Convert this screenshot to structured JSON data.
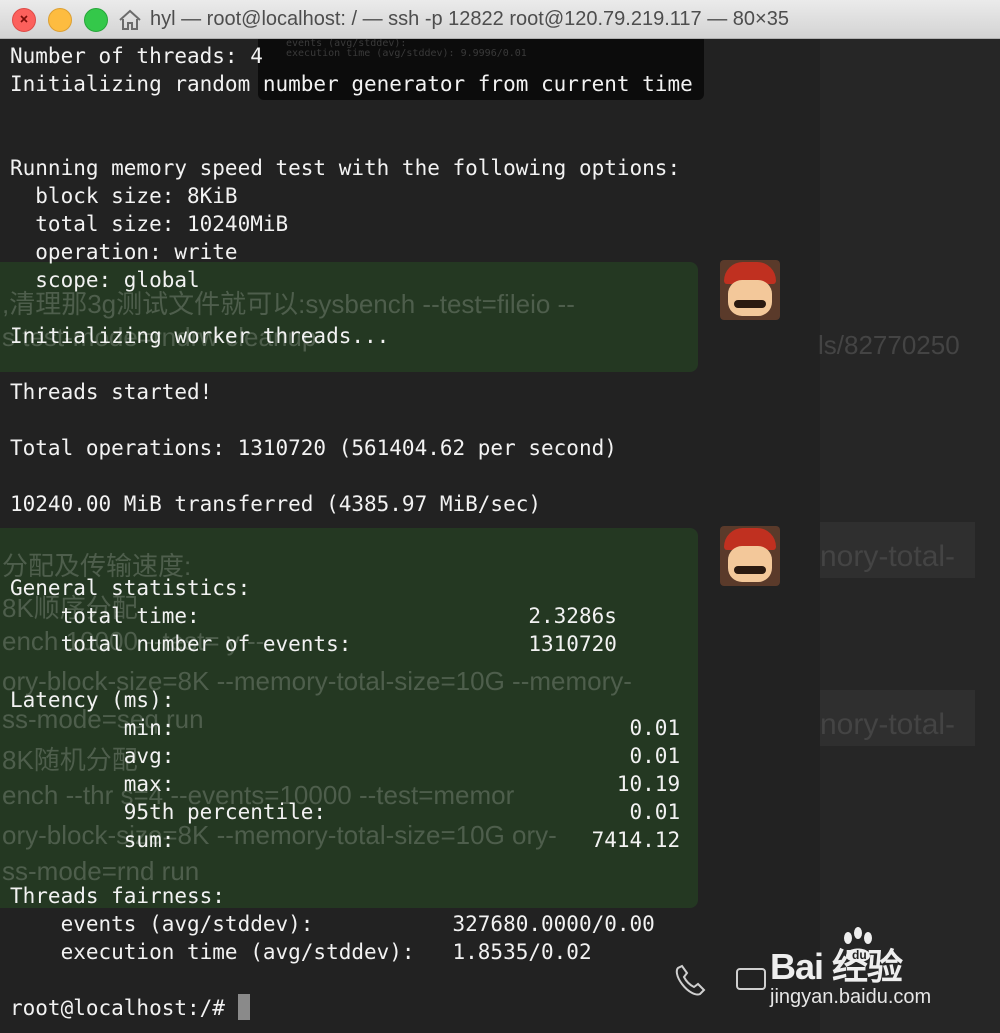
{
  "window": {
    "title": "hyl — root@localhost: / — ssh -p 12822 root@120.79.219.117 — 80×35"
  },
  "overlay": {
    "lines": [
      "events (avg/stddev):",
      "execution time (avg/stddev):    9.9996/0.01"
    ]
  },
  "background_chat": {
    "bubble1": [
      ",清理那3g测试文件就可以:sysbench --test=fileio --",
      "s                                           test-mode=rndrw cleanup"
    ],
    "bubble2": [
      "分配及传输速度:",
      "8K顺序分配",
      "ench                                 10000 --test=                  y --",
      "ory-block-size=8K --memory-total-size=10G --memory-",
      "ss-mode=seq run",
      "8K随机分配",
      "ench --thr       s=4 --events=10000 --test=memor",
      "ory-block-size=8K --memory-total-size=10G        ory-",
      "ss-mode=rnd run"
    ],
    "right_texts": [
      "ls/82770250",
      "nory-total-",
      "nory-total-"
    ]
  },
  "terminal": {
    "lines": [
      "Number of threads: 4",
      "Initializing random number generator from current time",
      "",
      "",
      "Running memory speed test with the following options:",
      "  block size: 8KiB",
      "  total size: 10240MiB",
      "  operation: write",
      "  scope: global",
      "",
      "Initializing worker threads...",
      "",
      "Threads started!",
      "",
      "Total operations: 1310720 (561404.62 per second)",
      "",
      "10240.00 MiB transferred (4385.97 MiB/sec)",
      "",
      "",
      "General statistics:",
      "    total time:                          2.3286s",
      "    total number of events:              1310720",
      "",
      "Latency (ms):",
      "         min:                                    0.01",
      "         avg:                                    0.01",
      "         max:                                   10.19",
      "         95th percentile:                        0.01",
      "         sum:                                 7414.12",
      "",
      "Threads fairness:",
      "    events (avg/stddev):           327680.0000/0.00",
      "    execution time (avg/stddev):   1.8535/0.02",
      "",
      "root@localhost:/# "
    ]
  },
  "watermark": {
    "brand": "Bai  经验",
    "url": "jingyan.baidu.com"
  },
  "colors": {
    "terminal_text": "#f2f2f2",
    "bubble": "#243822"
  }
}
